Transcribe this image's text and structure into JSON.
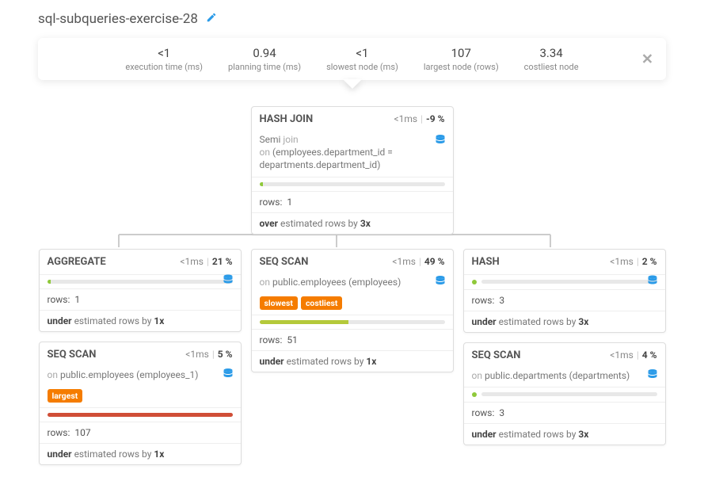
{
  "header": {
    "title": "sql-subqueries-exercise-28"
  },
  "stats": [
    {
      "value": "<1",
      "label": "execution time (ms)"
    },
    {
      "value": "0.94",
      "label": "planning time (ms)"
    },
    {
      "value": "<1",
      "label": "slowest node (ms)"
    },
    {
      "value": "107",
      "label": "largest node (rows)"
    },
    {
      "value": "3.34",
      "label": "costliest node"
    }
  ],
  "root": {
    "title": "HASH JOIN",
    "time": "<1ms",
    "pct": "-9 %",
    "semi_label": "Semi",
    "join_word": "join",
    "on_label": "on",
    "condition": "(employees.department_id = departments.department_id)",
    "rows_label": "rows:",
    "rows": "1",
    "est_prefix": "over",
    "est_mid": "estimated rows by",
    "est_factor": "3x"
  },
  "agg": {
    "title": "AGGREGATE",
    "time": "<1ms",
    "pct": "21 %",
    "rows_label": "rows:",
    "rows": "1",
    "est_prefix": "under",
    "est_mid": "estimated rows by",
    "est_factor": "1x"
  },
  "seqEmp1": {
    "title": "SEQ SCAN",
    "time": "<1ms",
    "pct": "5 %",
    "on_label": "on",
    "target": "public.employees (employees_1)",
    "tag_largest": "largest",
    "rows_label": "rows:",
    "rows": "107",
    "est_prefix": "under",
    "est_mid": "estimated rows by",
    "est_factor": "1x"
  },
  "seqEmp": {
    "title": "SEQ SCAN",
    "time": "<1ms",
    "pct": "49 %",
    "on_label": "on",
    "target": "public.employees (employees)",
    "tag_slowest": "slowest",
    "tag_costliest": "costliest",
    "rows_label": "rows:",
    "rows": "51",
    "est_prefix": "under",
    "est_mid": "estimated rows by",
    "est_factor": "1x"
  },
  "hash": {
    "title": "HASH",
    "time": "<1ms",
    "pct": "2 %",
    "rows_label": "rows:",
    "rows": "3",
    "est_prefix": "under",
    "est_mid": "estimated rows by",
    "est_factor": "3x"
  },
  "seqDept": {
    "title": "SEQ SCAN",
    "time": "<1ms",
    "pct": "4 %",
    "on_label": "on",
    "target": "public.departments (departments)",
    "rows_label": "rows:",
    "rows": "3",
    "est_prefix": "under",
    "est_mid": "estimated rows by",
    "est_factor": "3x"
  }
}
